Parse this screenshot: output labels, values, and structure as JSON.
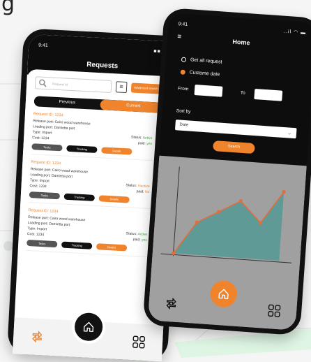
{
  "brand_letter": "g",
  "colors": {
    "accent": "#f0842c",
    "dark": "#111111",
    "chart_fill": "#5f9a96",
    "chart_line": "#e36e3c"
  },
  "left": {
    "status_time": "9:41",
    "status_icons": "■■ ◠",
    "title": "Requests",
    "search_placeholder": "Request Id",
    "advanced_label": "Advanced search",
    "tabs": [
      "Previous",
      "Current"
    ],
    "cards": [
      {
        "id": "Request ID: 1234",
        "release": "Release port: Cairo wood warehouse",
        "loading": "Loading port: Damietta port",
        "type": "Type: Import",
        "status_label": "Status: ",
        "status_value": "Active",
        "cost": "Cost: 1234",
        "paid_label": "paid: ",
        "paid_value": "yes",
        "buttons": [
          "Tasks",
          "Tracking",
          "Details"
        ]
      },
      {
        "id": "Request ID: 1234",
        "release": "Release port: Cairo wood warehouse",
        "loading": "Loading port: Damietta port",
        "type": "Type: Import",
        "status_label": "Status: ",
        "status_value": "Inactive",
        "cost": "Cost: 1234",
        "paid_label": "paid: ",
        "paid_value": "No",
        "buttons": [
          "Tasks",
          "Tracking",
          "Details"
        ]
      },
      {
        "id": "Request ID: 1234",
        "release": "Release port: Cairo wood warehouse",
        "loading": "Loading port: Damietta port",
        "type": "Type: Import",
        "status_label": "Status: ",
        "status_value": "Active",
        "cost": "Cost: 1234",
        "paid_label": "paid: ",
        "paid_value": "yes",
        "buttons": [
          "Tasks",
          "Tracking",
          "Details"
        ]
      }
    ],
    "nav_icons": [
      "transfer-icon",
      "home-icon",
      "grid-icon"
    ]
  },
  "right": {
    "status_time": "9:41",
    "status_icons": "..il ◠ ▬",
    "title": "Home",
    "radio_all": "Get all request",
    "radio_date": "Custome date",
    "from_label": "From",
    "to_label": "To",
    "sort_label": "Sort by",
    "sort_value": "Date",
    "search_label": "Search",
    "nav_icons": [
      "transfer-icon",
      "home-icon",
      "grid-icon"
    ]
  },
  "chart_data": {
    "type": "area",
    "x": [
      0,
      1,
      2,
      3,
      4,
      5
    ],
    "values": [
      0,
      40,
      55,
      70,
      45,
      85
    ],
    "title": "",
    "xlabel": "",
    "ylabel": "",
    "ylim": [
      0,
      100
    ],
    "grid": false
  }
}
